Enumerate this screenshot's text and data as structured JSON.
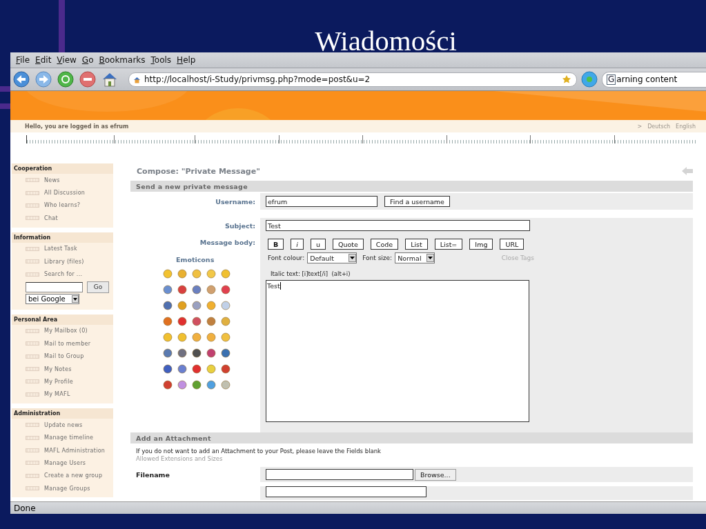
{
  "slide": {
    "title": "Wiadomości"
  },
  "menu": [
    {
      "label": "File"
    },
    {
      "label": "Edit"
    },
    {
      "label": "View"
    },
    {
      "label": "Go"
    },
    {
      "label": "Bookmarks"
    },
    {
      "label": "Tools"
    },
    {
      "label": "Help"
    }
  ],
  "toolbar": {
    "url": "http://localhost/i-Study/privmsg.php?mode=post&u=2",
    "search_engine": "G",
    "search_text": "arning content"
  },
  "header": {
    "greeting": "Hello, you are logged in as efrum",
    "arrow": ">",
    "languages": [
      "Deutsch",
      "English"
    ]
  },
  "sidebar": [
    {
      "title": "Cooperation",
      "items": [
        "News",
        "All Discussion",
        "Who learns?",
        "Chat"
      ]
    },
    {
      "title": "Information",
      "items": [
        "Latest Task",
        "Library (files)",
        "Search for ..."
      ],
      "search": {
        "button": "Go",
        "engine": "bei Google"
      }
    },
    {
      "title": "Personal Area",
      "items": [
        "My Mailbox (0)",
        "Mail to member",
        "Mail to Group",
        "My Notes",
        "My Profile",
        "My MAFL"
      ]
    },
    {
      "title": "Administration",
      "items": [
        "Update news",
        "Manage timeline",
        "MAFL Administration",
        "Manage Users",
        "Create a new group",
        "Manage Groups"
      ]
    }
  ],
  "compose": {
    "title": "Compose: \"Private Message\"",
    "section": "Send a new private message",
    "username_label": "Username:",
    "username": "efrum",
    "find_button": "Find a username",
    "subject_label": "Subject:",
    "subject": "Test",
    "body_label": "Message body:",
    "emoticons_title": "Emoticons",
    "format_buttons": [
      {
        "label": "B",
        "kind": "bold"
      },
      {
        "label": "i",
        "kind": "italic"
      },
      {
        "label": "u",
        "kind": "plain"
      },
      {
        "label": "Quote",
        "kind": "plain"
      },
      {
        "label": "Code",
        "kind": "plain"
      },
      {
        "label": "List",
        "kind": "plain"
      },
      {
        "label": "List=",
        "kind": "plain"
      },
      {
        "label": "Img",
        "kind": "plain"
      },
      {
        "label": "URL",
        "kind": "plain"
      }
    ],
    "font_colour_label": "Font colour:",
    "font_colour": "Default",
    "font_size_label": "Font size:",
    "font_size": "Normal",
    "close_tags": "Close Tags",
    "hint": "Italic text: [i]text[/i]  (alt+i)",
    "body": "Test"
  },
  "attachment": {
    "title": "Add an Attachment",
    "note": "If you do not want to add an Attachment to your Post, please leave the Fields blank",
    "allowed": "Allowed Extensions and Sizes",
    "filename_label": "Filename",
    "browse": "Browse..."
  },
  "status_bar": "Done"
}
